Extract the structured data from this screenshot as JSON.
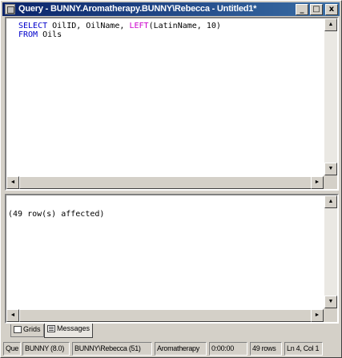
{
  "window": {
    "title": "Query - BUNNY.Aromatherapy.BUNNY\\Rebecca - Untitled1*",
    "buttons": {
      "minimize": "_",
      "maximize": "□",
      "close": "x"
    }
  },
  "editor": {
    "lines": [
      {
        "kw1": "SELECT",
        "t1": " OilID, OilName, ",
        "fn": "LEFT",
        "t2": "(LatinName, 10)"
      },
      {
        "kw1": "FROM",
        "t1": " Oils"
      }
    ]
  },
  "results": {
    "message": "(49 row(s) affected)"
  },
  "tabs": [
    {
      "label": "Grids",
      "active": false
    },
    {
      "label": "Messages",
      "active": true
    }
  ],
  "status": {
    "mode": "Que",
    "server": "BUNNY (8.0)",
    "user": "BUNNY\\Rebecca (51)",
    "database": "Aromatherapy",
    "time": "0:00:00",
    "rows": "49 rows",
    "position": "Ln 4, Col 1"
  },
  "scroll": {
    "up": "▲",
    "down": "▼",
    "left": "◄",
    "right": "►"
  },
  "colors": {
    "titlebar_start": "#0a246a",
    "titlebar_end": "#3a6ea5",
    "keyword": "#0000cc",
    "function": "#cc00cc"
  }
}
